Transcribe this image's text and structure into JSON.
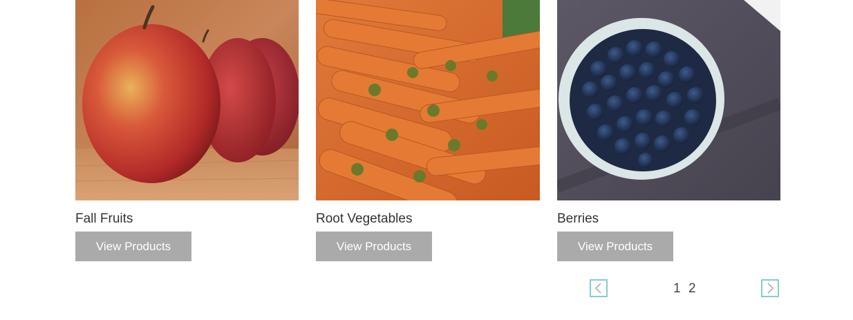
{
  "categories": [
    {
      "title": "Fall Fruits",
      "button_label": "View Products",
      "image": "red-apples-photo"
    },
    {
      "title": "Root Vegetables",
      "button_label": "View Products",
      "image": "carrots-photo"
    },
    {
      "title": "Berries",
      "button_label": "View Products",
      "image": "blueberries-bowl-photo"
    }
  ],
  "pagination": {
    "prev_icon": "chevron-left-icon",
    "next_icon": "chevron-right-icon",
    "pages": [
      "1",
      "2"
    ]
  },
  "colors": {
    "button_bg": "#aaaaaa",
    "button_text": "#ffffff",
    "pager_border": "#7fcfcc",
    "title_text": "#333333"
  }
}
